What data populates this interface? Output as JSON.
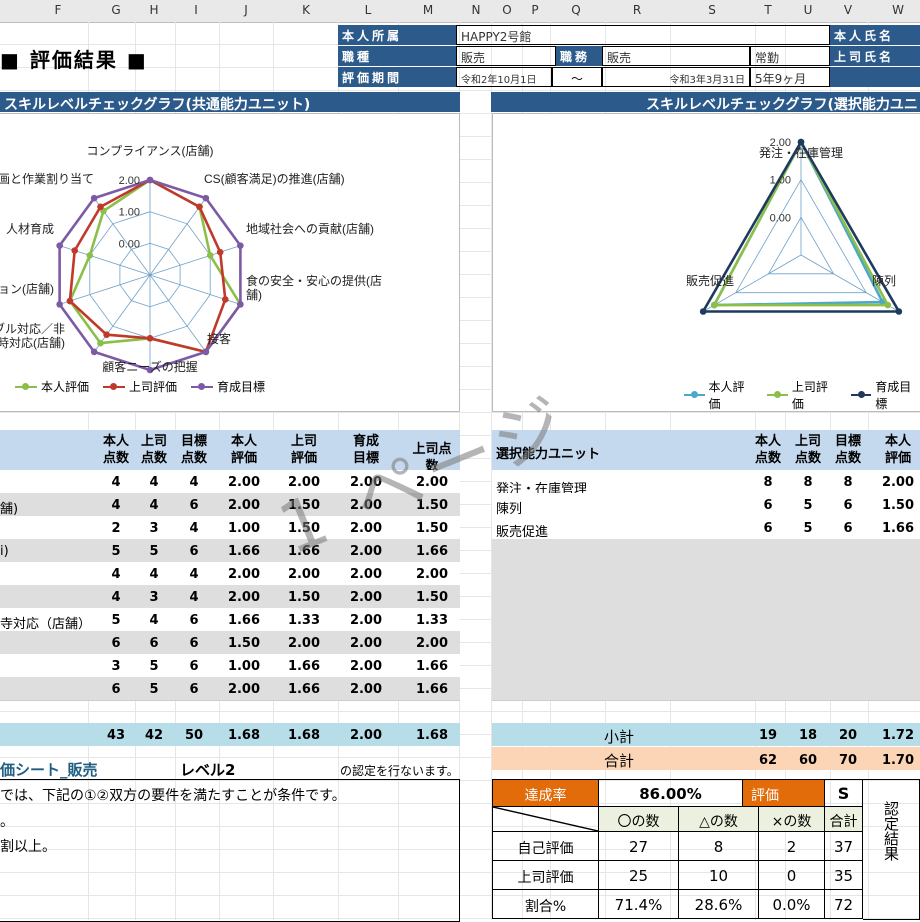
{
  "columns": [
    "F",
    "G",
    "H",
    "I",
    "J",
    "K",
    "L",
    "M",
    "N",
    "O",
    "P",
    "Q",
    "R",
    "S",
    "T",
    "U",
    "V",
    "W"
  ],
  "title": "■ 評価結果 ■",
  "info": {
    "shozoku_label": "本人所属",
    "shozoku_value": "HAPPY2号館",
    "shokushu_label": "職種",
    "shokushu_value": "販売",
    "shokumu_label": "職務",
    "shokumu_value": "販売",
    "kinmu_value": "常勤",
    "kikan_label": "評価期間",
    "kikan_start": "令和2年10月1日",
    "kikan_sep": "～",
    "kikan_end": "令和3年3月31日",
    "kikan_length": "5年9ヶ月",
    "honnin_label": "本人氏名",
    "joshi_label": "上司氏名"
  },
  "chart_left": {
    "header": "スキルレベルチェックグラフ(共通能力ユニット)",
    "chart_data": {
      "type": "radar",
      "axes": [
        "コンプライアンス(店舗)",
        "CS(顧客満足)の推進(店舗)",
        "地域社会への貢献(店舗)",
        "食の安全・安心の提供(店舗)",
        "接客",
        "顧客ニーズの把握",
        "トラブル対応/非常時対応(店舗)",
        "コミュニケーション(店舗)",
        "人材育成",
        "作業計画と作業割り当て"
      ],
      "axis_labels": [
        "コンプライアンス(店舗)",
        "CS(顧客満足)の推進(店舗)",
        "地域社会への貢献(店舗)",
        "食の安全・安心の提供(店\n舗)",
        "接客",
        "顧客ニーズの把握",
        "・トラブル対応／非\n時対応(店舗)",
        "ョン(店舗)",
        "人材育成",
        "画と作業割り当て"
      ],
      "ticks": [
        "0.00",
        "1.00",
        "2.00"
      ],
      "rmin": -1,
      "rmax": 2,
      "series": [
        {
          "name": "本人評価",
          "color": "#8cbf4a",
          "values": [
            2.0,
            1.66,
            1.0,
            2.0,
            2.0,
            1.0,
            1.66,
            1.66,
            1.0,
            1.5
          ]
        },
        {
          "name": "上司評価",
          "color": "#c0392b",
          "values": [
            2.0,
            1.66,
            1.33,
            1.5,
            2.0,
            1.0,
            1.33,
            1.66,
            1.5,
            1.66
          ]
        },
        {
          "name": "育成目標",
          "color": "#7d5aa6",
          "values": [
            2.0,
            2.0,
            2.0,
            2.0,
            2.0,
            2.0,
            2.0,
            2.0,
            2.0,
            2.0
          ]
        }
      ]
    }
  },
  "chart_right": {
    "header": "スキルレベルチェックグラフ(選択能力ユニ",
    "chart_data": {
      "type": "radar",
      "axes": [
        "発注・在庫管理",
        "陳列",
        "販売促進"
      ],
      "axis_labels": [
        "発注・在庫管理",
        "陳列",
        "販売促進"
      ],
      "ticks": [
        "0.00",
        "1.00",
        "2.00"
      ],
      "rmin": -1,
      "rmax": 2,
      "series": [
        {
          "name": "本人評価",
          "color": "#4aa8c9",
          "values": [
            2.0,
            1.5,
            1.66
          ]
        },
        {
          "name": "上司評価",
          "color": "#8cbf4a",
          "values": [
            2.0,
            1.66,
            1.66
          ]
        },
        {
          "name": "育成目標",
          "color": "#1f3a5f",
          "values": [
            2.0,
            2.0,
            2.0
          ]
        }
      ]
    }
  },
  "watermark": "1 ページ",
  "left_table": {
    "headers": [
      [
        "本人",
        "点数"
      ],
      [
        "上司",
        "点数"
      ],
      [
        "目標",
        "点数"
      ],
      [
        "本人",
        "評価"
      ],
      [
        "上司",
        "評価"
      ],
      [
        "育成",
        "目標"
      ],
      [
        "上司点数"
      ]
    ],
    "rows": [
      {
        "label": "",
        "vals": [
          "4",
          "4",
          "4",
          "2.00",
          "2.00",
          "2.00",
          "2.00"
        ],
        "shade": false
      },
      {
        "label": "舗)",
        "vals": [
          "4",
          "4",
          "6",
          "2.00",
          "1.50",
          "2.00",
          "1.50"
        ],
        "shade": true
      },
      {
        "label": "",
        "vals": [
          "2",
          "3",
          "4",
          "1.00",
          "1.50",
          "2.00",
          "1.50"
        ],
        "shade": false
      },
      {
        "label": "i)",
        "vals": [
          "5",
          "5",
          "6",
          "1.66",
          "1.66",
          "2.00",
          "1.66"
        ],
        "shade": true
      },
      {
        "label": "",
        "vals": [
          "4",
          "4",
          "4",
          "2.00",
          "2.00",
          "2.00",
          "2.00"
        ],
        "shade": false
      },
      {
        "label": "",
        "vals": [
          "4",
          "3",
          "4",
          "2.00",
          "1.50",
          "2.00",
          "1.50"
        ],
        "shade": true
      },
      {
        "label": "寺対応（店舗）",
        "vals": [
          "5",
          "4",
          "6",
          "1.66",
          "1.33",
          "2.00",
          "1.33"
        ],
        "shade": false
      },
      {
        "label": "",
        "vals": [
          "6",
          "6",
          "6",
          "1.50",
          "2.00",
          "2.00",
          "2.00"
        ],
        "shade": true
      },
      {
        "label": "",
        "vals": [
          "3",
          "5",
          "6",
          "1.00",
          "1.66",
          "2.00",
          "1.66"
        ],
        "shade": false
      },
      {
        "label": "",
        "vals": [
          "6",
          "5",
          "6",
          "2.00",
          "1.66",
          "2.00",
          "1.66"
        ],
        "shade": true
      }
    ],
    "total": [
      "43",
      "42",
      "50",
      "1.68",
      "1.68",
      "2.00",
      "1.68"
    ]
  },
  "right_table": {
    "header_label": "選択能力ユニット",
    "headers": [
      [
        "本人",
        "点数"
      ],
      [
        "上司",
        "点数"
      ],
      [
        "目標",
        "点数"
      ],
      [
        "本人",
        "評価"
      ]
    ],
    "rows": [
      {
        "label": "発注・在庫管理",
        "vals": [
          "8",
          "8",
          "8",
          "2.00"
        ]
      },
      {
        "label": "陳列",
        "vals": [
          "6",
          "5",
          "6",
          "1.50"
        ]
      },
      {
        "label": "販売促進",
        "vals": [
          "6",
          "5",
          "6",
          "1.66"
        ]
      }
    ],
    "subtotal_label": "小計",
    "subtotal": [
      "19",
      "18",
      "20",
      "1.72"
    ],
    "total_label": "合計",
    "total": [
      "62",
      "60",
      "70",
      "1.70"
    ]
  },
  "bottom": {
    "sheet_name": "価シート_販売",
    "level": "レベル2",
    "nintei_text": "の認定を行ないます。",
    "line1": "では、下記の①②双方の要件を満たすことが条件です。",
    "line2": "。",
    "line3": "割以上。"
  },
  "score": {
    "achieve_label": "達成率",
    "achieve_value": "86.00%",
    "eval_label": "評価",
    "eval_value": "S",
    "col_heads": [
      "〇の数",
      "△の数",
      "×の数",
      "合計"
    ],
    "rows": [
      {
        "label": "自己評価",
        "vals": [
          "27",
          "8",
          "2",
          "37"
        ]
      },
      {
        "label": "上司評価",
        "vals": [
          "25",
          "10",
          "0",
          "35"
        ]
      },
      {
        "label": "割合%",
        "vals": [
          "71.4%",
          "28.6%",
          "0.0%",
          "72"
        ]
      }
    ],
    "nintei_label": "認定結果"
  },
  "colors": {
    "header_blue": "#2c5a8a",
    "table_head": "#c5d9ee",
    "subtotal": "#b7dde8",
    "total": "#fbd5b5",
    "orange": "#e26b0a",
    "shade": "#dedede"
  }
}
